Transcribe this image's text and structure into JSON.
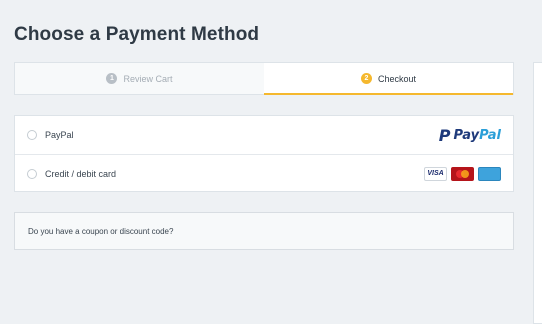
{
  "page": {
    "title": "Choose a Payment Method"
  },
  "steps": [
    {
      "number": "1",
      "label": "Review Cart",
      "state": "inactive"
    },
    {
      "number": "2",
      "label": "Checkout",
      "state": "active"
    }
  ],
  "payment_methods": [
    {
      "label": "PayPal",
      "logo_text_1": "Pay",
      "logo_text_2": "Pal",
      "logo_mark": "P"
    },
    {
      "label": "Credit / debit card",
      "cards": [
        "VISA",
        "MasterCard",
        "AMERICAN EXPRESS"
      ]
    }
  ],
  "coupon": {
    "label": "Do you have a coupon or discount code?"
  },
  "colors": {
    "accent": "#f5b82e",
    "paypal_dark": "#1e3a7b",
    "paypal_light": "#2a9fd8"
  }
}
